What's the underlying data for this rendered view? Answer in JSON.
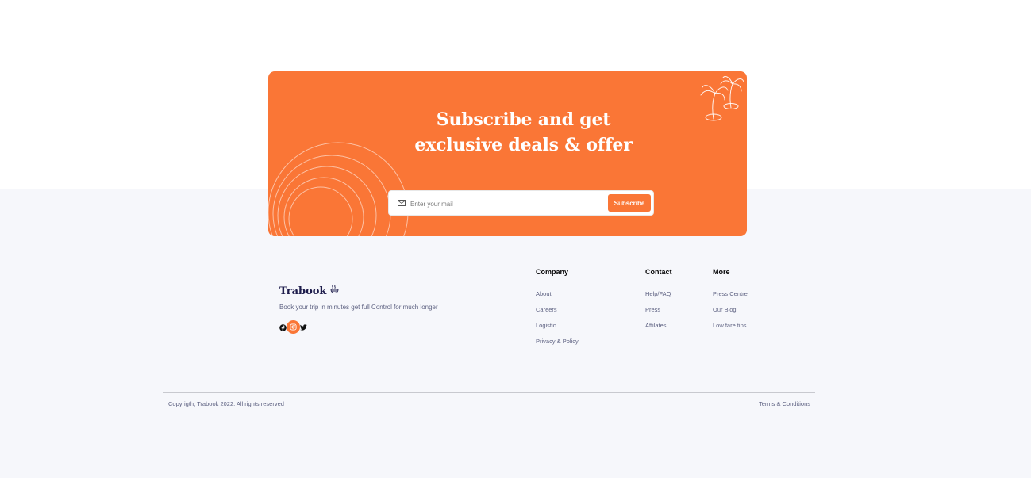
{
  "subscribe": {
    "title_line1": "Subscribe and get",
    "title_line2": "exclusive deals & offer",
    "email_placeholder": "Enter your mail",
    "button_label": "Subscribe",
    "accent_color": "#fa7636"
  },
  "brand": {
    "name": "Trabook",
    "tagline": "Book your trip in minutes get full Control for much longer",
    "logo_icon": "coffee-steam-icon"
  },
  "socials": [
    {
      "icon": "facebook-icon"
    },
    {
      "icon": "instagram-icon",
      "active": true
    },
    {
      "icon": "twitter-icon"
    }
  ],
  "columns": [
    {
      "title": "Company",
      "links": [
        "About",
        "Careers",
        "Logistic",
        "Privacy & Policy"
      ]
    },
    {
      "title": "Contact",
      "links": [
        "Help/FAQ",
        "Press",
        "Affilates"
      ]
    },
    {
      "title": "More",
      "links": [
        "Press Centre",
        "Our Blog",
        "Low fare tips"
      ]
    }
  ],
  "bottom": {
    "copyright": "Copyrigth, Trabook 2022. All rights reserved",
    "terms": "Terms & Conditions"
  }
}
